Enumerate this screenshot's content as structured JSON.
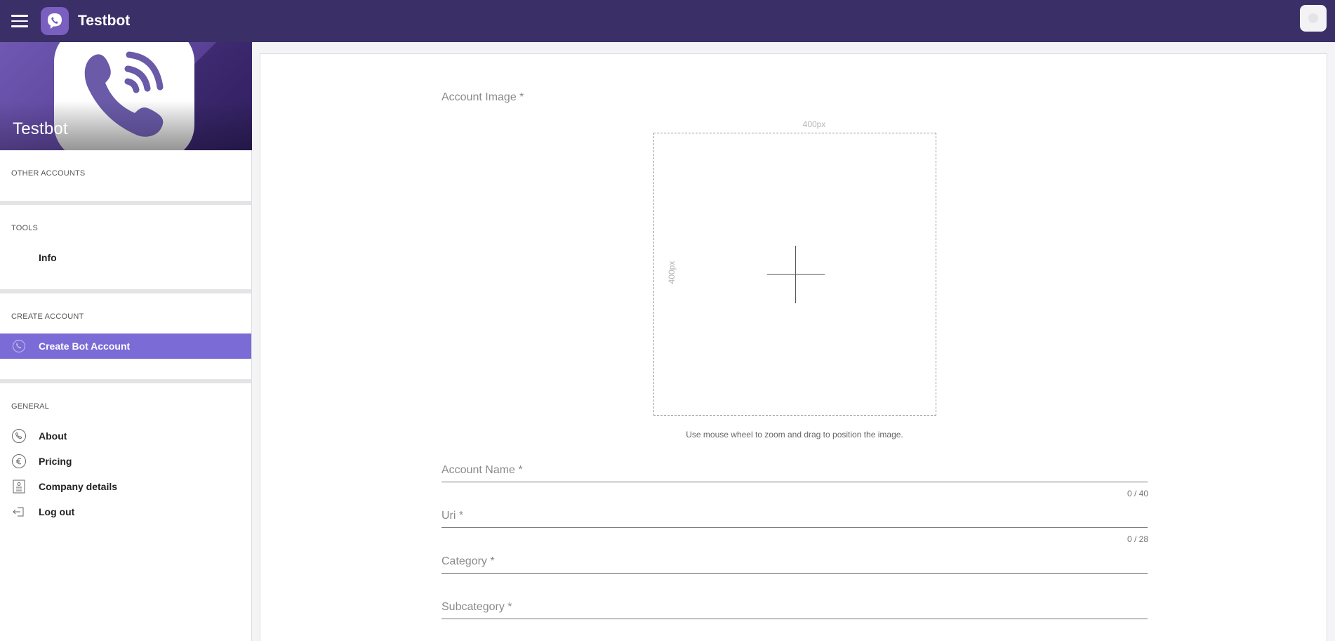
{
  "header": {
    "title": "Testbot",
    "menu_icon": "hamburger-menu-icon",
    "logo_icon": "viber-logo-icon"
  },
  "sidebar": {
    "account_name": "Testbot",
    "sections": [
      {
        "title": "OTHER ACCOUNTS",
        "items": []
      },
      {
        "title": "TOOLS",
        "items": [
          {
            "label": "Info",
            "icon": ""
          }
        ]
      },
      {
        "title": "CREATE ACCOUNT",
        "items": [
          {
            "label": "Create Bot Account",
            "icon": "viber-icon",
            "active": true
          }
        ]
      },
      {
        "title": "GENERAL",
        "items": [
          {
            "label": "About",
            "icon": "viber-icon"
          },
          {
            "label": "Pricing",
            "icon": "euro-icon"
          },
          {
            "label": "Company details",
            "icon": "id-card-icon"
          },
          {
            "label": "Log out",
            "icon": "logout-icon"
          }
        ]
      }
    ]
  },
  "form": {
    "image_label": "Account Image *",
    "image_width_label": "400px",
    "image_height_label": "400px",
    "image_hint": "Use mouse wheel to zoom and drag to position the image.",
    "account_name": {
      "placeholder": "Account Name *",
      "value": "",
      "counter": "0 / 40"
    },
    "uri": {
      "placeholder": "Uri *",
      "value": "",
      "counter": "0 / 28"
    },
    "category": {
      "placeholder": "Category *",
      "value": ""
    },
    "subcategory": {
      "placeholder": "Subcategory *",
      "value": ""
    }
  },
  "colors": {
    "header_bg": "#3a2f66",
    "active_item_bg": "#7a6bd6",
    "brand_purple": "#665cac"
  }
}
